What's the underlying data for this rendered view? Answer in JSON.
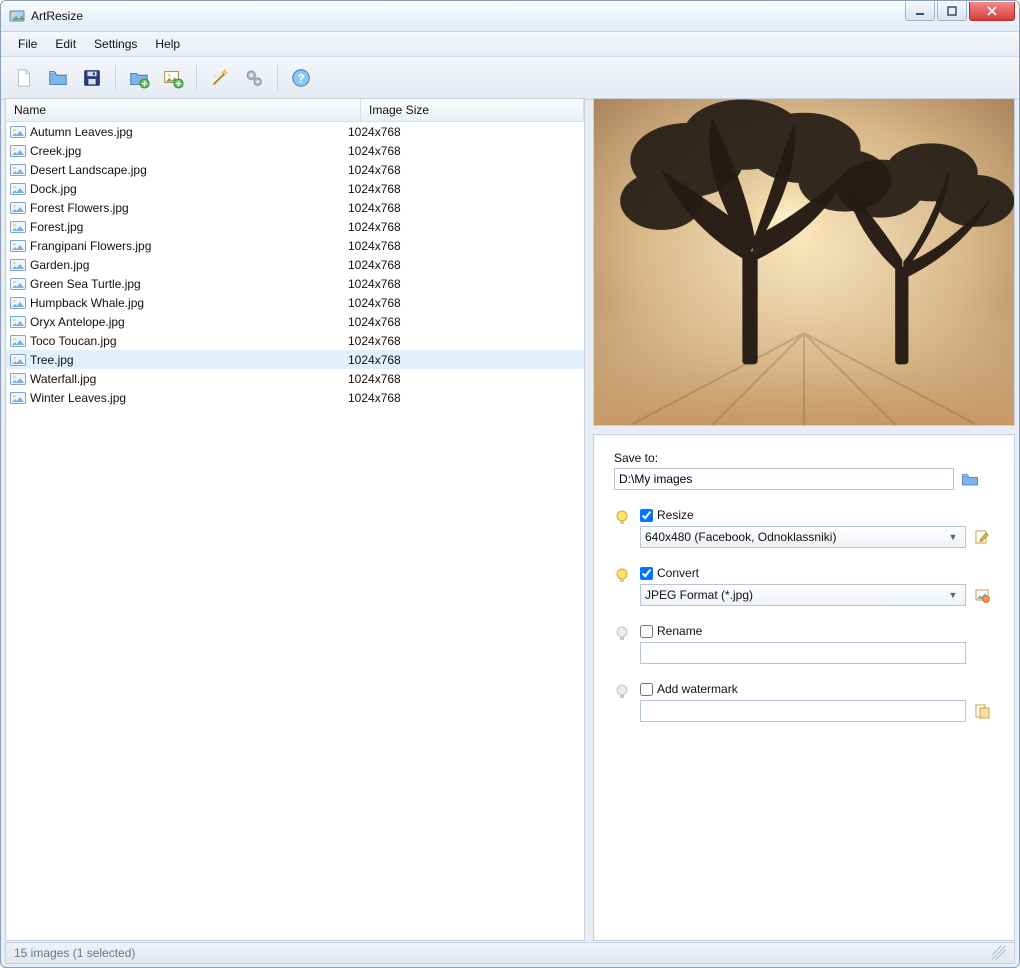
{
  "window": {
    "title": "ArtResize"
  },
  "menu": {
    "items": [
      "File",
      "Edit",
      "Settings",
      "Help"
    ]
  },
  "toolbar": {
    "icons": [
      "new-file",
      "open-folder",
      "save-disk",
      "add-folder",
      "add-image",
      "magic-wand",
      "gears",
      "help"
    ]
  },
  "filelist": {
    "columns": {
      "name": "Name",
      "size": "Image Size"
    },
    "selected_index": 12,
    "files": [
      {
        "name": "Autumn Leaves.jpg",
        "size": "1024x768"
      },
      {
        "name": "Creek.jpg",
        "size": "1024x768"
      },
      {
        "name": "Desert Landscape.jpg",
        "size": "1024x768"
      },
      {
        "name": "Dock.jpg",
        "size": "1024x768"
      },
      {
        "name": "Forest Flowers.jpg",
        "size": "1024x768"
      },
      {
        "name": "Forest.jpg",
        "size": "1024x768"
      },
      {
        "name": "Frangipani Flowers.jpg",
        "size": "1024x768"
      },
      {
        "name": "Garden.jpg",
        "size": "1024x768"
      },
      {
        "name": "Green Sea Turtle.jpg",
        "size": "1024x768"
      },
      {
        "name": "Humpback Whale.jpg",
        "size": "1024x768"
      },
      {
        "name": "Oryx Antelope.jpg",
        "size": "1024x768"
      },
      {
        "name": "Toco Toucan.jpg",
        "size": "1024x768"
      },
      {
        "name": "Tree.jpg",
        "size": "1024x768"
      },
      {
        "name": "Waterfall.jpg",
        "size": "1024x768"
      },
      {
        "name": "Winter Leaves.jpg",
        "size": "1024x768"
      }
    ]
  },
  "options": {
    "save_to_label": "Save to:",
    "save_to_value": "D:\\My images",
    "resize": {
      "label": "Resize",
      "checked": true,
      "value": "640x480 (Facebook, Odnoklassniki)"
    },
    "convert": {
      "label": "Convert",
      "checked": true,
      "value": "JPEG Format (*.jpg)"
    },
    "rename": {
      "label": "Rename",
      "checked": false,
      "value": ""
    },
    "watermark": {
      "label": "Add watermark",
      "checked": false,
      "value": ""
    }
  },
  "statusbar": {
    "text": "15 images (1 selected)"
  }
}
